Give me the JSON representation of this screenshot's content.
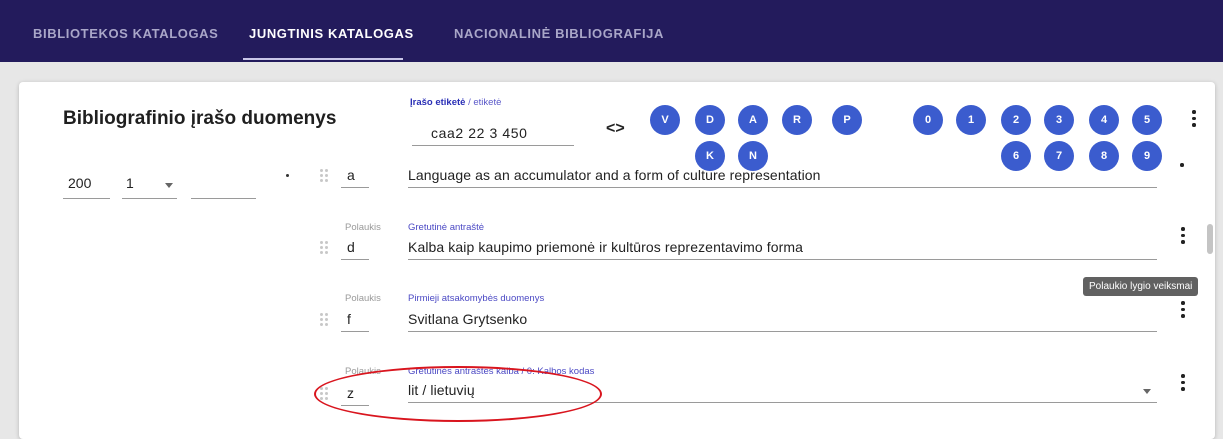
{
  "nav": {
    "tabs": [
      {
        "label": "BIBLIOTEKOS KATALOGAS",
        "active": false
      },
      {
        "label": "JUNGTINIS KATALOGAS",
        "active": true
      },
      {
        "label": "NACIONALINĖ BIBLIOGRAFIJA",
        "active": false
      }
    ]
  },
  "record": {
    "title": "Bibliografinio įrašo duomenys",
    "label": {
      "caption_primary": "Įrašo etiketė",
      "caption_secondary": " / etiketė",
      "value": "caa2 22   3 450"
    },
    "letter_buttons": [
      "V",
      "D",
      "A",
      "R",
      "P",
      "K",
      "N"
    ],
    "number_buttons": [
      "0",
      "1",
      "2",
      "3",
      "4",
      "5",
      "6",
      "7",
      "8",
      "9"
    ]
  },
  "field": {
    "tag": "200",
    "indicator1": "1",
    "indicator2": "",
    "subfield_caption": "Polaukis",
    "subfields": [
      {
        "code": "a",
        "caption": "",
        "value": "Language as an accumulator and a form of culture representation"
      },
      {
        "code": "d",
        "caption": "Gretutinė antraštė",
        "value": "Kalba kaip kaupimo priemonė ir kultūros reprezentavimo forma"
      },
      {
        "code": "f",
        "caption": "Pirmieji atsakomybės duomenys",
        "value": "Svitlana Grytsenko"
      },
      {
        "code": "z",
        "caption": "Gretutinės antraštės kalba / 0: Kalbos kodas",
        "value": "lit / lietuvių"
      }
    ]
  },
  "tooltip": "Polaukio lygio veiksmai",
  "colors": {
    "nav_bg": "#231b5c",
    "button_blue": "#3b5cce",
    "caption_blue": "#4b49c4",
    "annotation_red": "#d9151e"
  }
}
